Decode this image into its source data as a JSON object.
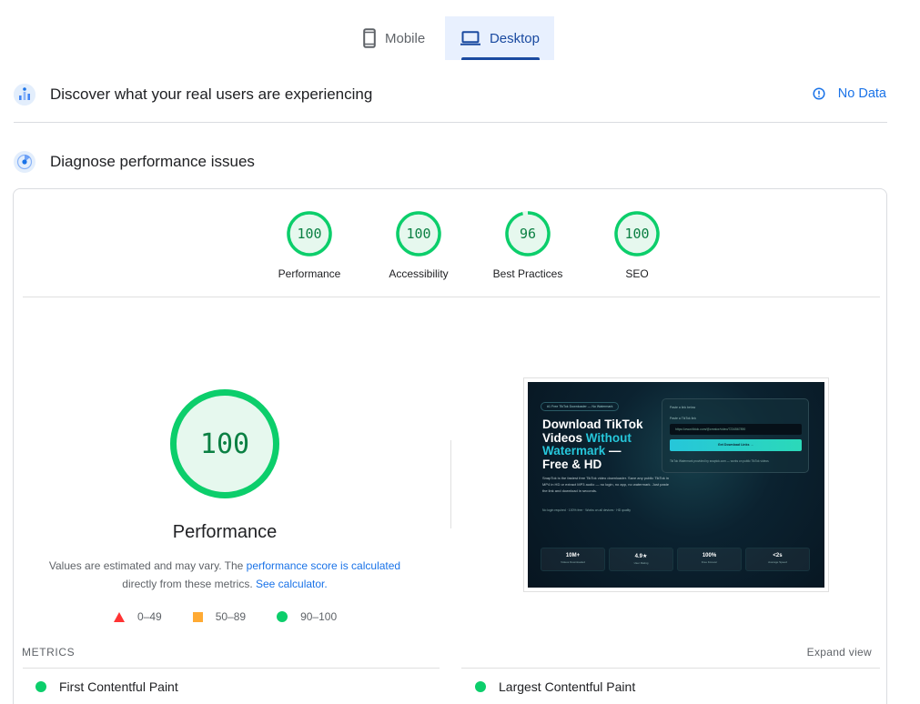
{
  "device_tabs": [
    {
      "label": "Mobile",
      "icon": "phone-icon",
      "active": false
    },
    {
      "label": "Desktop",
      "icon": "laptop-icon",
      "active": true
    }
  ],
  "crux": {
    "title": "Discover what your real users are experiencing",
    "status": "No Data",
    "icon": "users-chart-icon",
    "status_icon": "info-icon"
  },
  "diagnose": {
    "title": "Diagnose performance issues",
    "icon": "lighthouse-icon"
  },
  "scores": [
    {
      "label": "Performance",
      "value": "100",
      "fraction": 1.0
    },
    {
      "label": "Accessibility",
      "value": "100",
      "fraction": 1.0
    },
    {
      "label": "Best Practices",
      "value": "96",
      "fraction": 0.96
    },
    {
      "label": "SEO",
      "value": "100",
      "fraction": 1.0
    }
  ],
  "main_score": {
    "value": "100",
    "fraction": 1.0,
    "title": "Performance",
    "desc_prefix": "Values are estimated and may vary. The ",
    "desc_link1": "performance score is calculated",
    "desc_middle": "directly from these metrics.",
    "desc_link2": "See calculator."
  },
  "legend": [
    {
      "label": "0–49",
      "shape": "triangle",
      "color": "#ff3333"
    },
    {
      "label": "50–89",
      "shape": "square",
      "color": "#ffaa33"
    },
    {
      "label": "90–100",
      "shape": "circle",
      "color": "#0cce6b"
    }
  ],
  "screenshot": {
    "badge": "#1 Free TikTok Downloader — No Watermark",
    "title_line1": "Download TikTok",
    "title_line2a": "Videos ",
    "title_line2b": "Without",
    "title_line3a": "Watermark",
    "title_line3b": " —",
    "title_line4": "Free & HD",
    "description": "SnapTok is the fastest free TikTok video downloader. Save any public TikTok in MP4 in HD or extract MP3 audio — no login, no app, no watermark. Just paste the link and download in seconds.",
    "chips": "No login required · 100% free · Works on all devices · HD quality",
    "panel_header": "Paste a link below",
    "panel_label": "Paste a TikTok link",
    "panel_input": "https://www.tiktok.com/@creator/video/7234567890",
    "panel_button": "Get Download Links →",
    "panel_note": "TikTok Watermark provided by snaptok.com — works on public TikTok videos",
    "stats": [
      {
        "value": "10M+",
        "label": "Videos Downloaded"
      },
      {
        "value": "4.9★",
        "label": "User Rating"
      },
      {
        "value": "100%",
        "label": "Free Forever"
      },
      {
        "value": "<2s",
        "label": "Average Speed"
      }
    ]
  },
  "metrics": {
    "label": "METRICS",
    "expand": "Expand view",
    "items": [
      {
        "label": "First Contentful Paint",
        "status": "good"
      },
      {
        "label": "Largest Contentful Paint",
        "status": "good"
      }
    ]
  },
  "colors": {
    "good": "#0cce6b",
    "good_text": "#0b8043",
    "good_bg": "#e6f8ee",
    "accent": "#1a73e8",
    "tab_active": "#1a4aa0"
  }
}
